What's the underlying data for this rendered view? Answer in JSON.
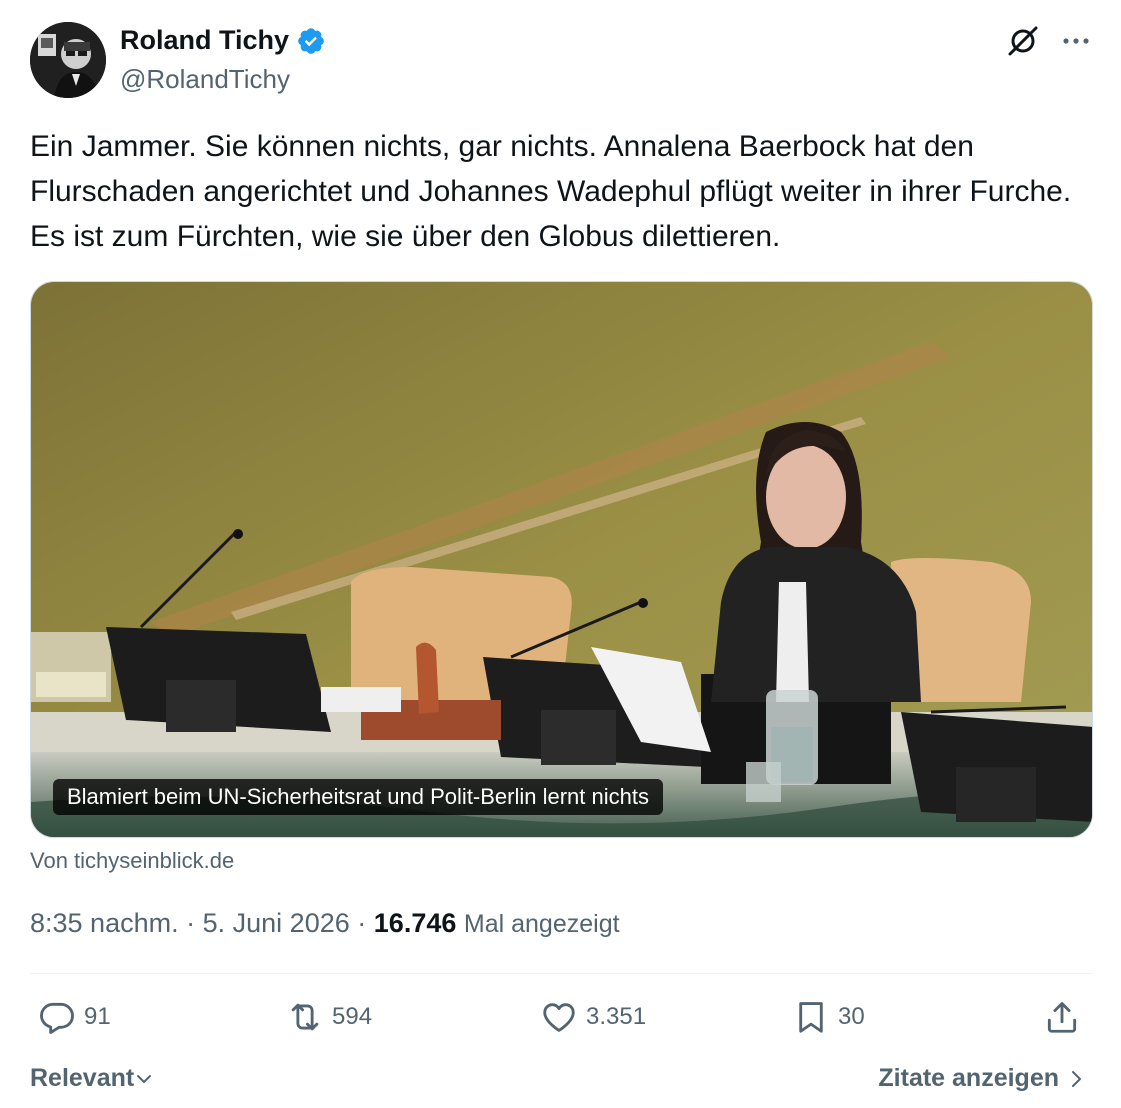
{
  "author": {
    "display_name": "Roland Tichy",
    "handle": "@RolandTichy",
    "verified": true,
    "verified_color": "#1d9bf0"
  },
  "header_icons": [
    "grok-icon",
    "more-icon"
  ],
  "tweet": {
    "text": "Ein Jammer. Sie können nichts, gar nichts. Annalena Baerbock hat den Flurschaden angerichtet und Johannes Wadephul pflügt weiter in ihrer Furche. Es ist zum Fürchten, wie sie über den Globus dilettieren."
  },
  "card": {
    "caption": "Blamiert beim UN-Sicherheitsrat und Polit-Berlin lernt nichts",
    "source": "Von tichyseinblick.de"
  },
  "meta": {
    "time": "8:35 nachm.",
    "separator": "·",
    "date": "5. Juni 2026",
    "views_count": "16.746",
    "views_label": "Mal angezeigt"
  },
  "actions": {
    "replies": "91",
    "reposts": "594",
    "likes": "3.351",
    "bookmarks": "30"
  },
  "footer": {
    "sort_label": "Relevant",
    "quotes_label": "Zitate anzeigen"
  },
  "colors": {
    "text_primary": "#0f1419",
    "text_secondary": "#536471",
    "divider": "#eff3f4"
  }
}
